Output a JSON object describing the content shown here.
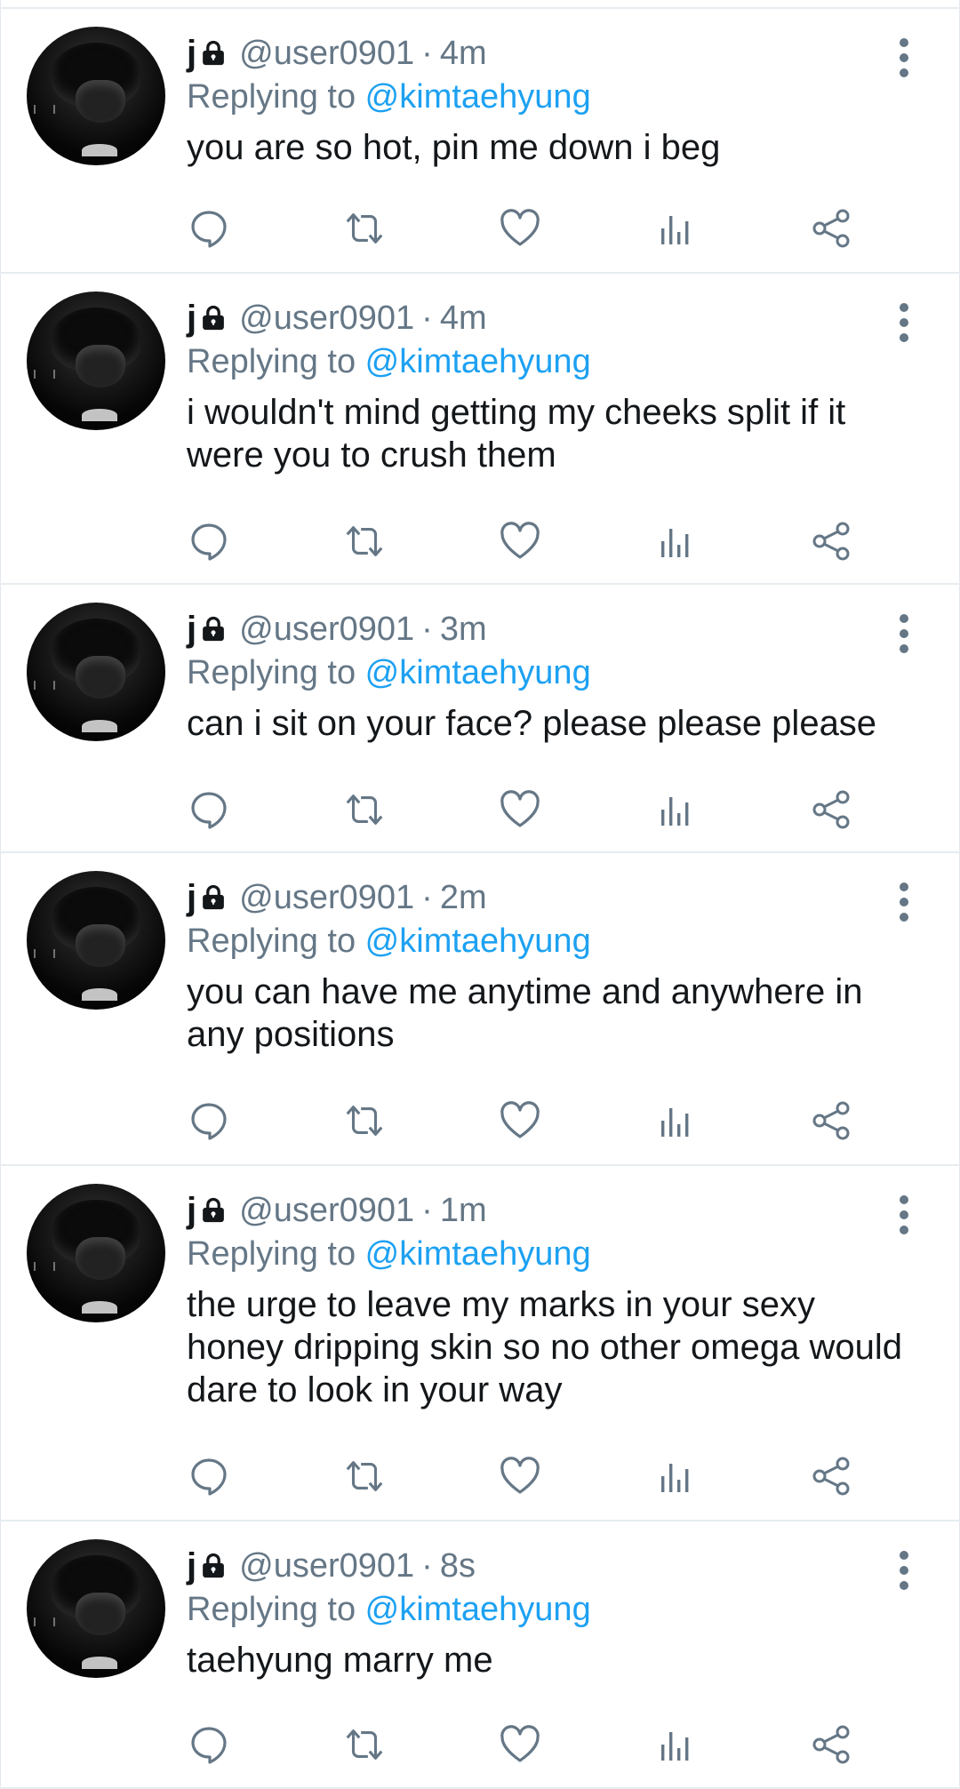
{
  "reply_prefix": "Replying to ",
  "tweets": [
    {
      "name": "j",
      "handle": "@user0901",
      "dot": "·",
      "time": "4m",
      "replying_to": "@kimtaehyung",
      "text": "you are so hot, pin me down i beg"
    },
    {
      "name": "j",
      "handle": "@user0901",
      "dot": "·",
      "time": "4m",
      "replying_to": "@kimtaehyung",
      "text": "i wouldn't mind getting my cheeks split if it were you to crush them"
    },
    {
      "name": "j",
      "handle": "@user0901",
      "dot": "·",
      "time": "3m",
      "replying_to": "@kimtaehyung",
      "text": "can i sit on your face? please please please"
    },
    {
      "name": "j",
      "handle": "@user0901",
      "dot": "·",
      "time": "2m",
      "replying_to": "@kimtaehyung",
      "text": "you can have me anytime and anywhere in any positions"
    },
    {
      "name": "j",
      "handle": "@user0901",
      "dot": "·",
      "time": "1m",
      "replying_to": "@kimtaehyung",
      "text": "the urge to leave my marks in your sexy honey dripping skin so no other omega would dare to look in your way"
    },
    {
      "name": "j",
      "handle": "@user0901",
      "dot": "·",
      "time": "8s",
      "replying_to": "@kimtaehyung",
      "text": "taehyung marry me"
    }
  ],
  "icons": {
    "lock": "lock-icon",
    "more": "more-vertical-icon",
    "reply": "reply-icon",
    "retweet": "retweet-icon",
    "like": "heart-icon",
    "stats": "analytics-icon",
    "share": "share-icon"
  },
  "colors": {
    "text": "#14171a",
    "secondary": "#657786",
    "link": "#1da1f2",
    "divider": "#e6ecf0"
  }
}
